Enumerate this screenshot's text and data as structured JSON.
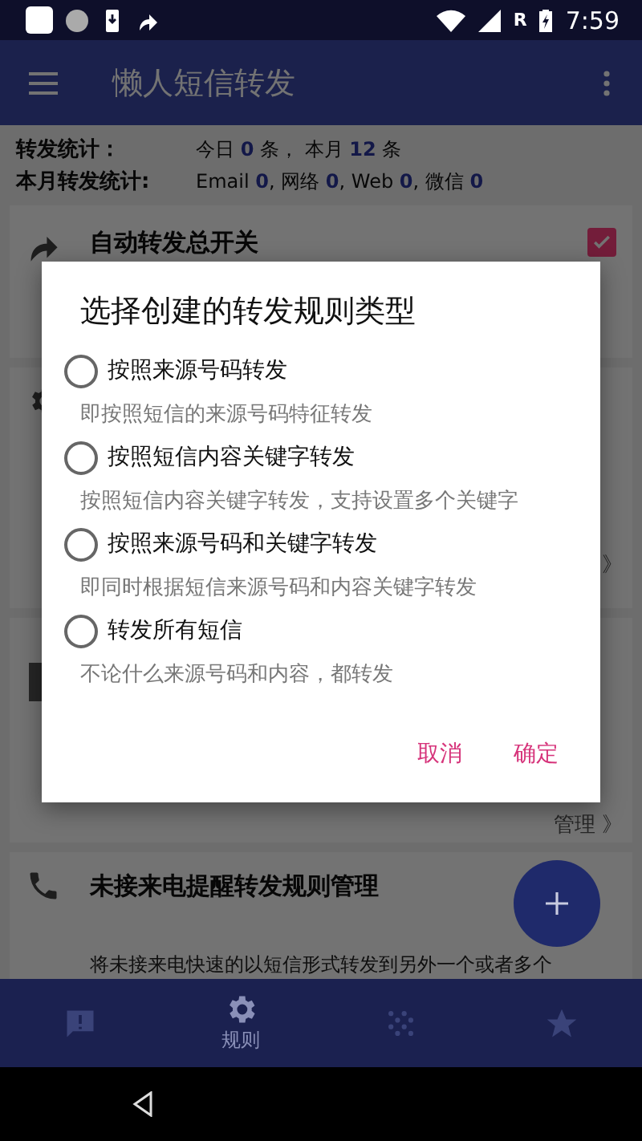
{
  "status_bar": {
    "network": "R",
    "time": "7:59"
  },
  "app_bar": {
    "title": "懒人短信转发"
  },
  "stats": [
    {
      "label": "转发统计：",
      "value": "今日 **0** 条， 本月 **12** 条"
    },
    {
      "label": "本月转发统计:",
      "value": "Email **0**, 网络 **0**, Web **0**, 微信 **0**"
    }
  ],
  "master_switch": {
    "label": "自动转发总开关",
    "checked": true
  },
  "rules_link": {
    "arrow": "》"
  },
  "manage_link": "管理 》",
  "missed_call": {
    "title": "未接来电提醒转发规则管理",
    "description": "将未接来电快速的以短信形式转发到另外一个或者多个"
  },
  "bottom_nav": [
    {
      "kind": "alert",
      "selected": false
    },
    {
      "kind": "settings",
      "label": "规则",
      "selected": true
    },
    {
      "kind": "dots",
      "selected": false
    },
    {
      "kind": "star",
      "selected": false
    }
  ],
  "dialog": {
    "title": "选择创建的转发规则类型",
    "options": [
      {
        "label": "按照来源号码转发",
        "description": "即按照短信的来源号码特征转发",
        "selected": false
      },
      {
        "label": "按照短信内容关键字转发",
        "description": "按照短信内容关键字转发，支持设置多个关键字",
        "selected": false
      },
      {
        "label": "按照来源号码和关键字转发",
        "description": "即同时根据短信来源号码和内容关键字转发",
        "selected": false
      },
      {
        "label": "转发所有短信",
        "description": "不论什么来源号码和内容，都转发",
        "selected": false
      }
    ],
    "buttons": [
      "取消",
      "确定"
    ]
  }
}
